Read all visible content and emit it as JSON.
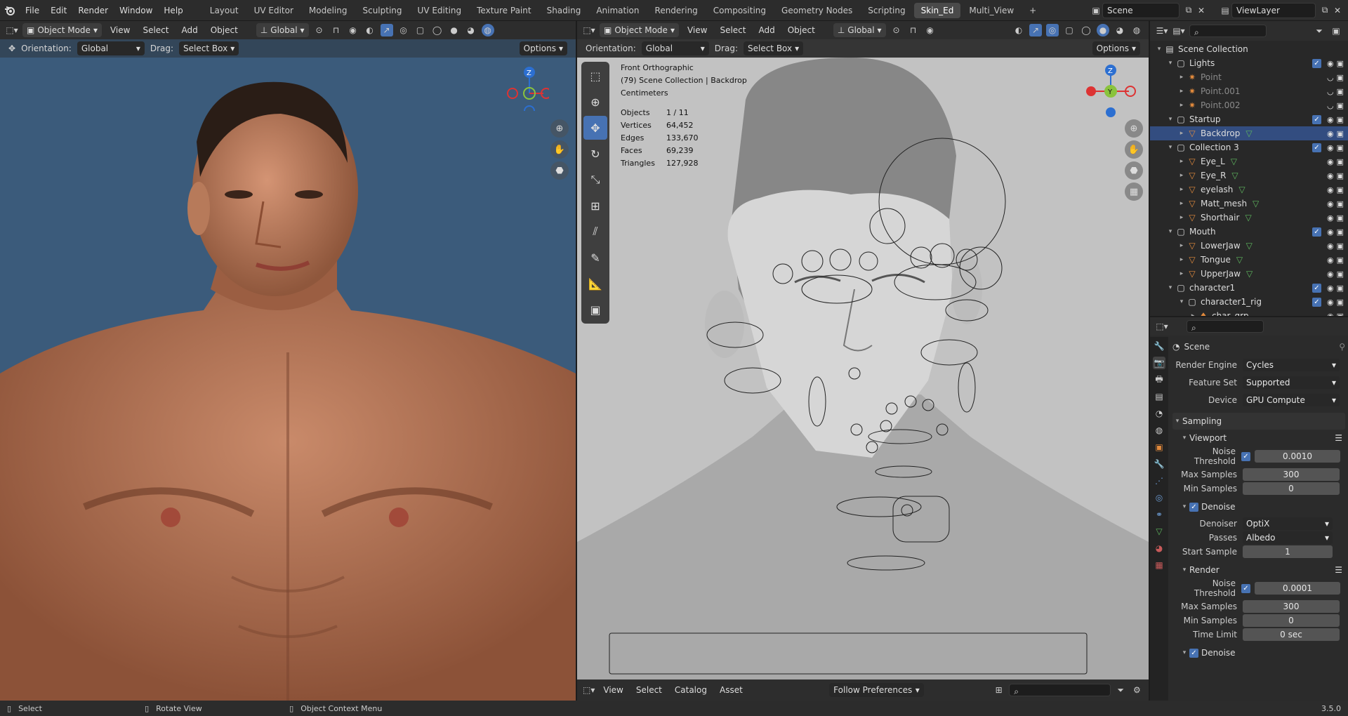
{
  "topbar": {
    "menus": [
      "File",
      "Edit",
      "Render",
      "Window",
      "Help"
    ],
    "workspaces": [
      "Layout",
      "UV Editor",
      "Modeling",
      "Sculpting",
      "UV Editing",
      "Texture Paint",
      "Shading",
      "Animation",
      "Rendering",
      "Compositing",
      "Geometry Nodes",
      "Scripting",
      "Skin_Ed",
      "Multi_View"
    ],
    "active_workspace": "Skin_Ed",
    "add_tab": "+",
    "scene": "Scene",
    "view_layer": "ViewLayer"
  },
  "left_view": {
    "mode": "Object Mode",
    "menus": [
      "View",
      "Select",
      "Add",
      "Object"
    ],
    "transform": "Global",
    "orientation_label": "Orientation:",
    "orientation_value": "Global",
    "drag_label": "Drag:",
    "drag_value": "Select Box",
    "options": "Options",
    "gizmo": {
      "z": "Z"
    },
    "background_color": "#3a5a7a"
  },
  "right_view": {
    "mode": "Object Mode",
    "menus": [
      "View",
      "Select",
      "Add",
      "Object"
    ],
    "transform": "Global",
    "orientation_label": "Orientation:",
    "orientation_value": "Global",
    "drag_label": "Drag:",
    "drag_value": "Select Box",
    "options": "Options",
    "overlay_title": "Front Orthographic",
    "overlay_collection": "(79) Scene Collection | Backdrop",
    "overlay_units": "Centimeters",
    "stats": [
      {
        "key": "Objects",
        "value": "1 / 11"
      },
      {
        "key": "Vertices",
        "value": "64,452"
      },
      {
        "key": "Edges",
        "value": "133,670"
      },
      {
        "key": "Faces",
        "value": "69,239"
      },
      {
        "key": "Triangles",
        "value": "127,928"
      }
    ],
    "gizmo": {
      "z": "Z",
      "y": "Y"
    }
  },
  "asset_bar": {
    "menus": [
      "View",
      "Select",
      "Catalog",
      "Asset"
    ],
    "follow": "Follow Preferences"
  },
  "outliner": {
    "rows": [
      {
        "label": "Scene Collection",
        "indent": 0,
        "type": "scene",
        "expanded": true
      },
      {
        "label": "Lights",
        "indent": 1,
        "type": "collection",
        "expanded": true,
        "check": true
      },
      {
        "label": "Point",
        "indent": 2,
        "type": "light",
        "dim": true
      },
      {
        "label": "Point.001",
        "indent": 2,
        "type": "light",
        "dim": true
      },
      {
        "label": "Point.002",
        "indent": 2,
        "type": "light",
        "dim": true
      },
      {
        "label": "Startup",
        "indent": 1,
        "type": "collection",
        "expanded": true,
        "check": true
      },
      {
        "label": "Backdrop",
        "indent": 2,
        "type": "mesh",
        "selected": true
      },
      {
        "label": "Collection 3",
        "indent": 1,
        "type": "collection",
        "expanded": true,
        "check": true
      },
      {
        "label": "Eye_L",
        "indent": 2,
        "type": "mesh"
      },
      {
        "label": "Eye_R",
        "indent": 2,
        "type": "mesh"
      },
      {
        "label": "eyelash",
        "indent": 2,
        "type": "mesh"
      },
      {
        "label": "Matt_mesh",
        "indent": 2,
        "type": "mesh"
      },
      {
        "label": "Shorthair",
        "indent": 2,
        "type": "mesh"
      },
      {
        "label": "Mouth",
        "indent": 1,
        "type": "collection",
        "expanded": true,
        "check": true
      },
      {
        "label": "LowerJaw",
        "indent": 2,
        "type": "mesh"
      },
      {
        "label": "Tongue",
        "indent": 2,
        "type": "mesh"
      },
      {
        "label": "UpperJaw",
        "indent": 2,
        "type": "mesh"
      },
      {
        "label": "character1",
        "indent": 1,
        "type": "collection",
        "expanded": true,
        "check": true
      },
      {
        "label": "character1_rig",
        "indent": 2,
        "type": "collection",
        "expanded": true,
        "check": true
      },
      {
        "label": "char_grp",
        "indent": 3,
        "type": "armature"
      }
    ]
  },
  "properties": {
    "context": "Scene",
    "render_engine_label": "Render Engine",
    "render_engine": "Cycles",
    "feature_set_label": "Feature Set",
    "feature_set": "Supported",
    "device_label": "Device",
    "device": "GPU Compute",
    "sampling": "Sampling",
    "viewport": "Viewport",
    "vp_noise_label": "Noise Threshold",
    "vp_noise": "0.0010",
    "vp_max_label": "Max Samples",
    "vp_max": "300",
    "vp_min_label": "Min Samples",
    "vp_min": "0",
    "vp_denoise": "Denoise",
    "denoiser_label": "Denoiser",
    "denoiser": "OptiX",
    "passes_label": "Passes",
    "passes": "Albedo",
    "start_label": "Start Sample",
    "start": "1",
    "render": "Render",
    "r_noise_label": "Noise Threshold",
    "r_noise": "0.0001",
    "r_max_label": "Max Samples",
    "r_max": "300",
    "r_min_label": "Min Samples",
    "r_min": "0",
    "time_label": "Time Limit",
    "time": "0 sec",
    "r_denoise": "Denoise"
  },
  "status": {
    "select": "Select",
    "rotate": "Rotate View",
    "context": "Object Context Menu",
    "version": "3.5.0"
  }
}
